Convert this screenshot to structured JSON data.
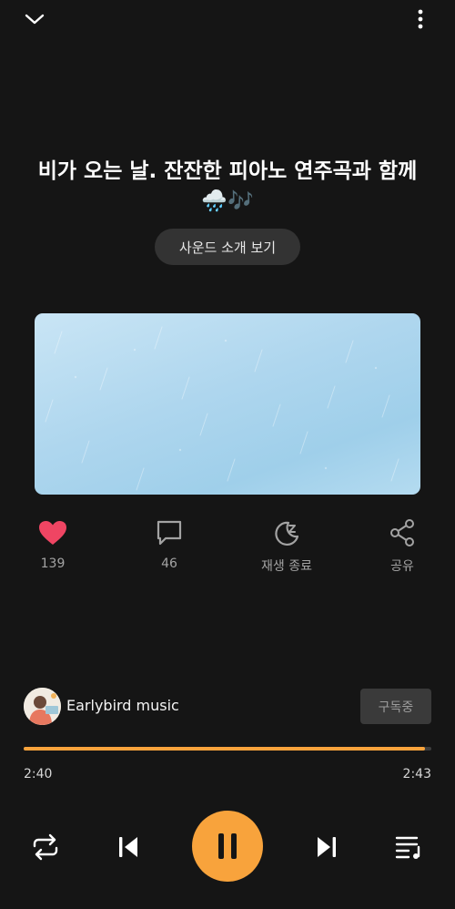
{
  "header": {
    "collapse_icon": "chevron-down-icon",
    "menu_icon": "more-vertical-icon"
  },
  "track": {
    "title": "비가 오는 날. 잔잔한 피아노 연주곡과 함께🌧️🎶"
  },
  "intro_button": {
    "label": "사운드 소개 보기"
  },
  "actions": {
    "like": {
      "icon": "heart-icon",
      "count": "139",
      "color": "#ef4563"
    },
    "comment": {
      "icon": "comment-icon",
      "count": "46"
    },
    "sleep_timer": {
      "icon": "moon-zz-icon",
      "label": "재생 종료"
    },
    "share": {
      "icon": "share-icon",
      "label": "공유"
    }
  },
  "channel": {
    "name": "Earlybird music",
    "subscribe_label": "구독중"
  },
  "progress": {
    "elapsed": "2:40",
    "total": "2:43",
    "fraction": 0.985,
    "accent": "#f8a33c"
  },
  "controls": {
    "repeat_icon": "repeat-icon",
    "previous_icon": "skip-previous-icon",
    "play_pause_icon": "pause-icon",
    "next_icon": "skip-next-icon",
    "playlist_icon": "playlist-icon"
  }
}
